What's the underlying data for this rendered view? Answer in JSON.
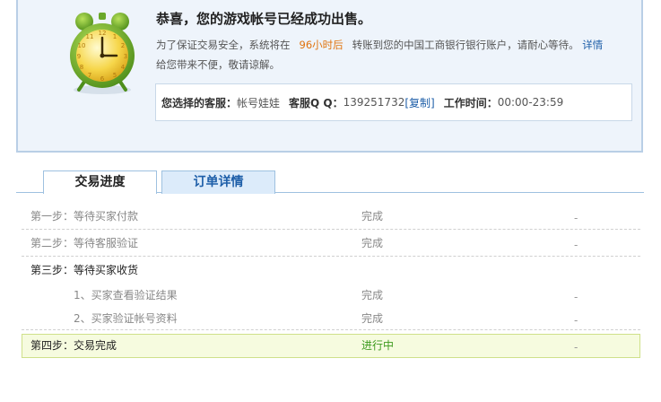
{
  "notice": {
    "title": "恭喜，您的游戏帐号已经成功出售。",
    "line1_prefix": "为了保证交易安全，系统将在",
    "line1_hours": "96小时后",
    "line1_suffix": "转账到您的中国工商银行银行账户，请耐心等待。",
    "details_link": "详情",
    "line2": "给您带来不便，敬请谅解。",
    "cs_label": "您选择的客服：",
    "cs_name": "帐号娃娃",
    "qq_label": "客服Q Q：",
    "qq_number": "139251732",
    "copy_link": "[复制]",
    "work_label": "工作时间：",
    "work_time": "00:00-23:59"
  },
  "tabs": [
    "交易进度",
    "订单详情"
  ],
  "steps": [
    {
      "name": "第一步：等待买家付款",
      "status": "完成",
      "extra": "-"
    },
    {
      "name": "第二步：等待客服验证",
      "status": "完成",
      "extra": "-"
    },
    {
      "name": "第三步：等待买家收货",
      "status": "",
      "extra": ""
    },
    {
      "name": "1、买家查看验证结果",
      "status": "完成",
      "extra": "-"
    },
    {
      "name": "2、买家验证帐号资料",
      "status": "完成",
      "extra": "-"
    },
    {
      "name": "第四步：交易完成",
      "status": "进行中",
      "extra": "-"
    }
  ],
  "colors": {
    "accent": "#1d5ea8",
    "hours": "#e0730d",
    "in_progress": "#3c9a1e"
  },
  "icons": {
    "clock": "alarm-clock-icon"
  }
}
